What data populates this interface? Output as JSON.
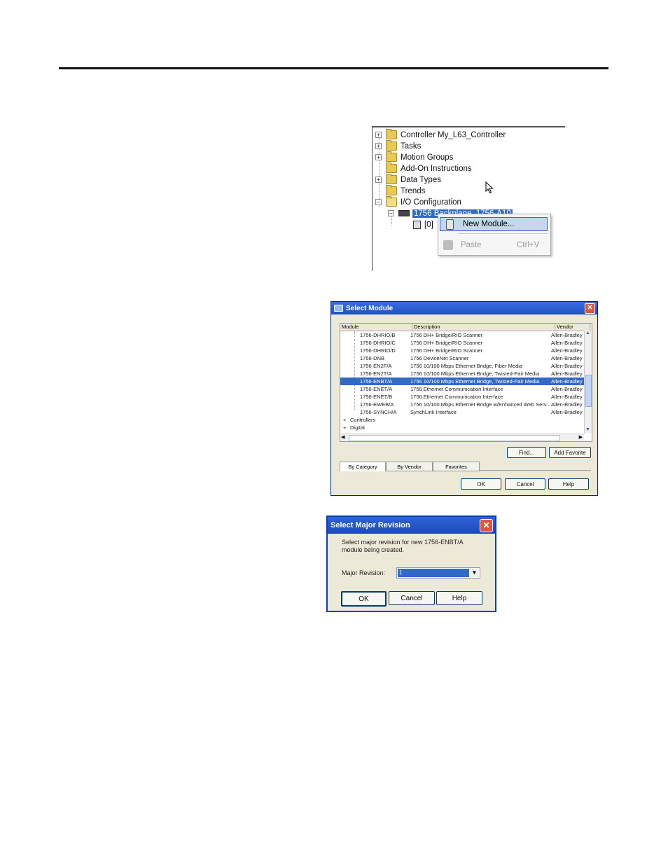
{
  "tree": {
    "items": [
      {
        "expander": "+",
        "label": "Controller My_L63_Controller"
      },
      {
        "expander": "+",
        "label": "Tasks"
      },
      {
        "expander": "+",
        "label": "Motion Groups"
      },
      {
        "expander": "",
        "label": "Add-On Instructions"
      },
      {
        "expander": "+",
        "label": "Data Types"
      },
      {
        "expander": "",
        "label": "Trends"
      },
      {
        "expander": "−",
        "label": "I/O Configuration"
      }
    ],
    "backplane": {
      "expander": "−",
      "label": "1756 Backplane, 1756-A10"
    },
    "slot": {
      "label": "[0]"
    }
  },
  "context_menu": {
    "new_module": "New Module...",
    "paste": "Paste",
    "paste_shortcut": "Ctrl+V"
  },
  "select_module": {
    "title": "Select Module",
    "columns": [
      "Module",
      "Description",
      "Vendor"
    ],
    "rows": [
      {
        "module": "1756-DHRIO/B",
        "description": "1756 DH+ Bridge/RIO Scanner",
        "vendor": "Allen-Bradley"
      },
      {
        "module": "1756-DHRIO/C",
        "description": "1756 DH+ Bridge/RIO Scanner",
        "vendor": "Allen-Bradley"
      },
      {
        "module": "1756-DHRIO/D",
        "description": "1756 DH+ Bridge/RIO Scanner",
        "vendor": "Allen-Bradley"
      },
      {
        "module": "1756-DNB",
        "description": "1756 DeviceNet Scanner",
        "vendor": "Allen-Bradley"
      },
      {
        "module": "1756-EN2F/A",
        "description": "1756 10/100 Mbps Ethernet Bridge, Fiber Media",
        "vendor": "Allen-Bradley"
      },
      {
        "module": "1756-EN2T/A",
        "description": "1756 10/100 Mbps Ethernet Bridge, Twisted-Pair Media",
        "vendor": "Allen-Bradley"
      },
      {
        "module": "1756-ENBT/A",
        "description": "1756 10/100 Mbps Ethernet Bridge, Twisted-Pair Media",
        "vendor": "Allen-Bradley",
        "selected": true
      },
      {
        "module": "1756-ENET/A",
        "description": "1756 Ethernet Communication Interface",
        "vendor": "Allen-Bradley"
      },
      {
        "module": "1756-ENET/B",
        "description": "1756 Ethernet Communication Interface",
        "vendor": "Allen-Bradley"
      },
      {
        "module": "1756-EWEB/A",
        "description": "1756 10/100 Mbps Ethernet Bridge w/Enhanced Web Serv...",
        "vendor": "Allen-Bradley"
      },
      {
        "module": "1756-SYNCH/A",
        "description": "SynchLink Interface",
        "vendor": "Allen-Bradley"
      }
    ],
    "categories": [
      {
        "expander": "+",
        "label": "Controllers"
      },
      {
        "expander": "+",
        "label": "Digital"
      }
    ],
    "find_button": "Find...",
    "add_favorite_button": "Add Favorite",
    "tabs": [
      "By Category",
      "By Vendor",
      "Favorites"
    ],
    "ok_button": "OK",
    "cancel_button": "Cancel",
    "help_button": "Help"
  },
  "major_revision": {
    "title": "Select Major Revision",
    "message_line1": "Select major revision for new 1756-ENBT/A",
    "message_line2": "module being created.",
    "field_label": "Major Revision:",
    "field_value": "1",
    "ok_button": "OK",
    "cancel_button": "Cancel",
    "help_button": "Help"
  }
}
